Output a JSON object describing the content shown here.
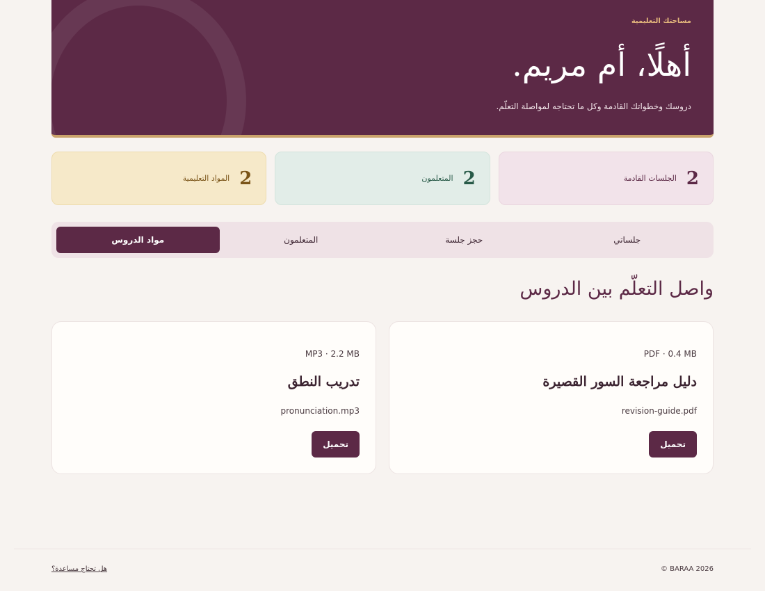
{
  "hero": {
    "eyebrow": "مساحتك التعليمية",
    "title": "أهلًا، أم مريم.",
    "subtitle": "دروسك وخطواتك القادمة وكل ما تحتاجه لمواصلة التعلّم."
  },
  "stats": [
    {
      "value": "2",
      "label": "الجلسات القادمة"
    },
    {
      "value": "2",
      "label": "المتعلمون"
    },
    {
      "value": "2",
      "label": "المواد التعليمية"
    }
  ],
  "tabs": [
    {
      "label": "جلساتي"
    },
    {
      "label": "حجز جلسة"
    },
    {
      "label": "المتعلمون"
    },
    {
      "label": "مواد الدروس"
    }
  ],
  "active_tab": "مواد الدروس",
  "section": {
    "title": "واصل التعلّم بين الدروس"
  },
  "materials": [
    {
      "meta": "PDF · 0.4 MB",
      "title": "دليل مراجعة السور القصيرة",
      "filename": "revision-guide.pdf",
      "button": "تحميل"
    },
    {
      "meta": "MP3 · 2.2 MB",
      "title": "تدريب النطق",
      "filename": "pronunciation.mp3",
      "button": "تحميل"
    }
  ],
  "footer": {
    "copyright": "© BARAA 2026",
    "help": "هل تحتاج مساعدة؟"
  },
  "colors": {
    "brand": "#5c2946",
    "accent": "#c9a26b",
    "background": "#f7f3f0"
  }
}
